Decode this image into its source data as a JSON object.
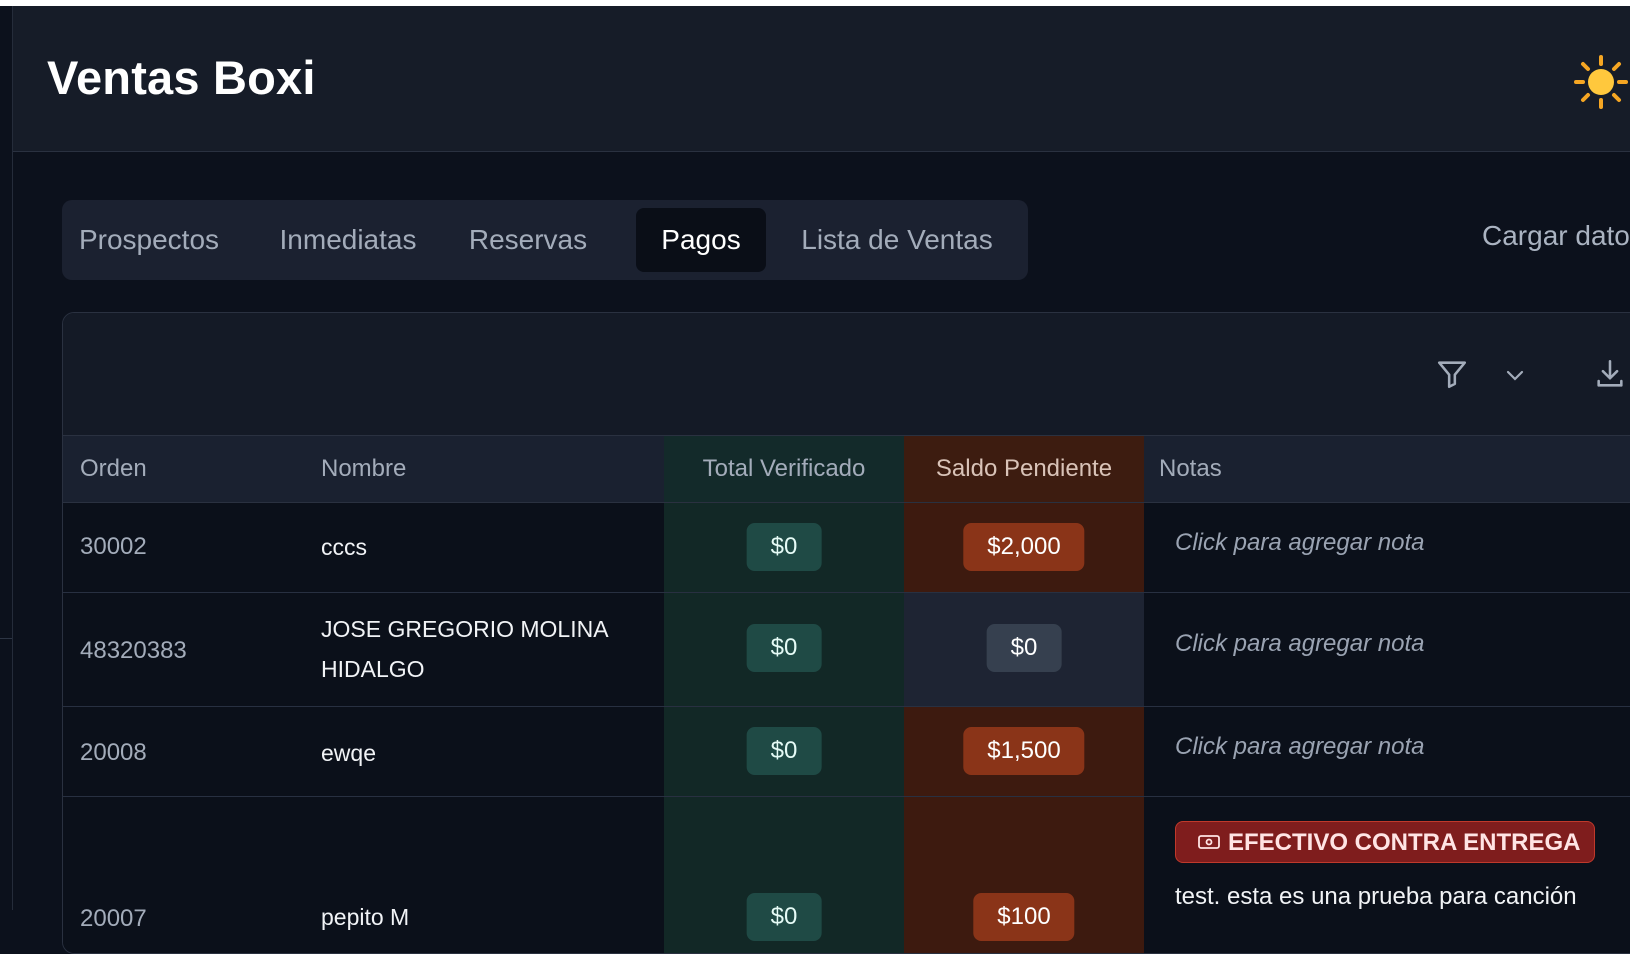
{
  "app": {
    "title": "Ventas Boxi",
    "theme_icon": "sun-icon"
  },
  "tabs": [
    {
      "label": "Prospectos",
      "active": false
    },
    {
      "label": "Inmediatas",
      "active": false
    },
    {
      "label": "Reservas",
      "active": false
    },
    {
      "label": "Pagos",
      "active": true
    },
    {
      "label": "Lista de Ventas",
      "active": false
    }
  ],
  "actions": {
    "load_data": "Cargar dato"
  },
  "toolbar": {
    "filter_icon": "filter-icon",
    "dropdown_icon": "chevron-down-icon",
    "download_icon": "download-icon"
  },
  "table": {
    "headers": {
      "order": "Orden",
      "name": "Nombre",
      "verified": "Total Verificado",
      "pending": "Saldo Pendiente",
      "notes": "Notas"
    },
    "rows": [
      {
        "order": "30002",
        "name": "cccs",
        "verified": "$0",
        "pending": "$2,000",
        "note": "Click para agregar nota"
      },
      {
        "order": "48320383",
        "name": "JOSE GREGORIO MOLINA HIDALGO",
        "verified": "$0",
        "pending": "$0",
        "note": "Click para agregar nota"
      },
      {
        "order": "20008",
        "name": "ewqe",
        "verified": "$0",
        "pending": "$1,500",
        "note": "Click para agregar nota"
      },
      {
        "order": "20007",
        "name": "pepito M",
        "verified": "$0",
        "pending": "$100",
        "badge": "EFECTIVO CONTRA ENTREGA",
        "note": "test. esta es una prueba para canción"
      }
    ]
  },
  "colors": {
    "background": "#0c111c",
    "verified": "#1f4a45",
    "pending": "#8a3418",
    "badge": "#7f1d1d"
  }
}
